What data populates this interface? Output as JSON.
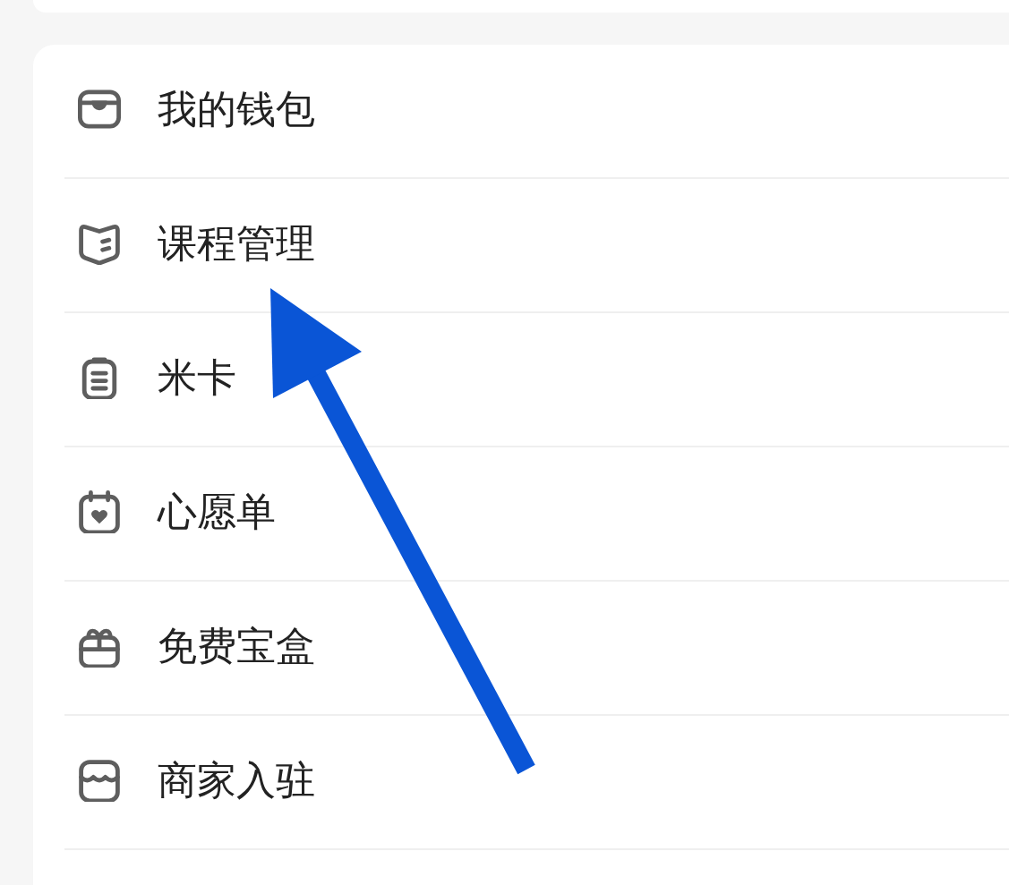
{
  "menu": {
    "items": [
      {
        "label": "我的钱包"
      },
      {
        "label": "课程管理"
      },
      {
        "label": "米卡"
      },
      {
        "label": "心愿单"
      },
      {
        "label": "免费宝盒"
      },
      {
        "label": "商家入驻"
      }
    ]
  }
}
